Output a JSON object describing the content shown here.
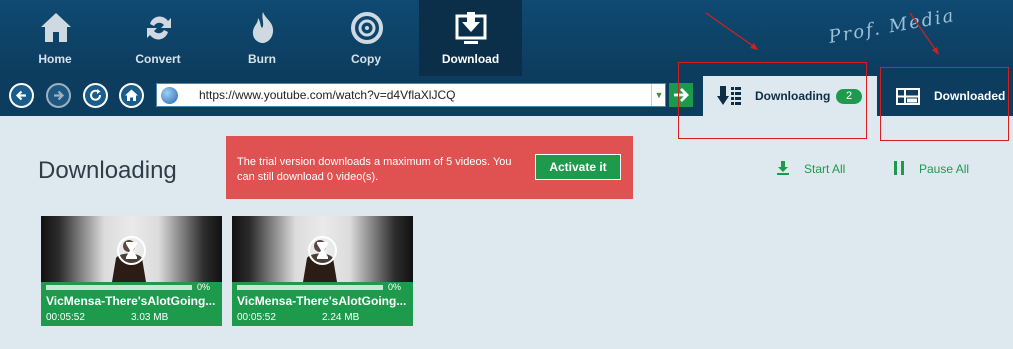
{
  "toolbar": {
    "items": [
      {
        "label": "Home",
        "icon": "home-icon"
      },
      {
        "label": "Convert",
        "icon": "convert-icon"
      },
      {
        "label": "Burn",
        "icon": "burn-icon"
      },
      {
        "label": "Copy",
        "icon": "copy-icon"
      },
      {
        "label": "Download",
        "icon": "download-icon",
        "active": true
      }
    ],
    "brand": "Prof. Media"
  },
  "nav": {
    "url": "https://www.youtube.com/watch?v=d4VflaXlJCQ"
  },
  "tabs": {
    "downloading_label": "Downloading",
    "downloading_count": "2",
    "downloaded_label": "Downloaded"
  },
  "main": {
    "title": "Downloading",
    "banner_message": "The trial version downloads a maximum of 5 videos. You can still download 0 video(s).",
    "banner_button": "Activate it",
    "start_all": "Start All",
    "pause_all": "Pause All"
  },
  "videos": [
    {
      "title": "VicMensa-There'sAlotGoing...",
      "duration": "00:05:52",
      "size": "3.03 MB",
      "progress": "0%"
    },
    {
      "title": "VicMensa-There'sAlotGoing...",
      "duration": "00:05:52",
      "size": "2.24 MB",
      "progress": "0%"
    }
  ],
  "colors": {
    "toolbar_bg": "#0f4a72",
    "accent_green": "#1e9a4c",
    "banner_red": "#e05252",
    "content_bg": "#dde9ee"
  }
}
